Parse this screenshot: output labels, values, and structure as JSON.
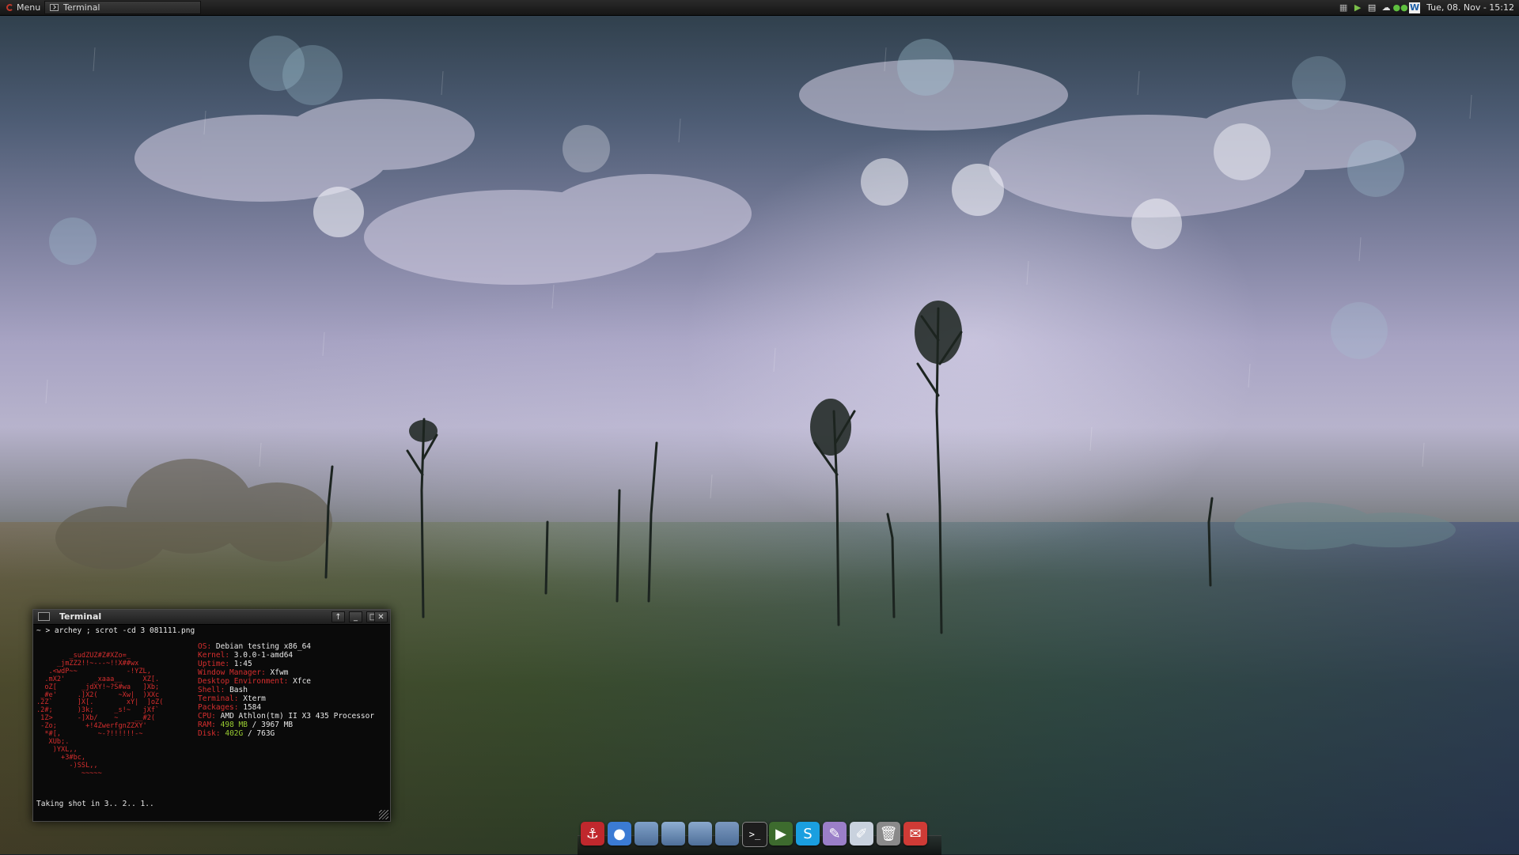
{
  "top_panel": {
    "menu_label": "Menu",
    "task_label": "Terminal",
    "clock": "Tue, 08. Nov - 15:12",
    "tray_icons": [
      "network-icon",
      "media-play-icon",
      "chat-icon",
      "cloud-icon",
      "eyes-icon",
      "writer-icon"
    ]
  },
  "terminal": {
    "title": "Terminal",
    "prompt": "~ > archey ; scrot -cd 3 081111.png",
    "ascii_logo": [
      "        _sudZUZ#Z#XZo=_",
      "     _jmZZ2!!~---~!!X##wx",
      "   .<wdP~~            -!YZL,",
      "  .mX2'       _xaaa__     XZ[.",
      "  oZ[      _jdXY!~?S#wa   ]Xb;",
      " _#e'     .]X2(     ~Xw|  )XXc",
      ".2Z`      ]X[.        xY|  ]oZ(",
      ".2#;      )3k;     _s!~   jXf`",
      " 1Z>      -]Xb/    ~    __#2(",
      " -Zo;       +!4ZwerfgnZZXY'",
      "  *#[,         ~-?!!!!!!-~",
      "   XUb;.",
      "    )YXL,,",
      "      +3#bc,",
      "        -)SSL,,",
      "           ~~~~~"
    ],
    "sysinfo": [
      {
        "key": "OS:",
        "value": "Debian testing x86_64"
      },
      {
        "key": "Kernel:",
        "value": "3.0.0-1-amd64"
      },
      {
        "key": "Uptime:",
        "value": "1:45"
      },
      {
        "key": "Window Manager:",
        "value": "Xfwm"
      },
      {
        "key": "Desktop Environment:",
        "value": "Xfce"
      },
      {
        "key": "Shell:",
        "value": "Bash"
      },
      {
        "key": "Terminal:",
        "value": "Xterm"
      },
      {
        "key": "Packages:",
        "value": "1584"
      },
      {
        "key": "CPU:",
        "value": "AMD Athlon(tm) II X3 435 Processor"
      }
    ],
    "ram": {
      "key": "RAM:",
      "used": "498 MB",
      "rest": " / 3967 MB"
    },
    "disk": {
      "key": "Disk:",
      "used": "402G",
      "rest": " / 763G"
    },
    "status_line": "Taking shot in 3.. 2.. 1..",
    "buttons": {
      "shade": "↑",
      "minimize": "_",
      "maximize": "□",
      "close": "✕"
    }
  },
  "dock": {
    "icons": [
      {
        "name": "anchor-icon",
        "glyph": "⚓",
        "color": "#c0282d"
      },
      {
        "name": "chromium-icon",
        "glyph": "●",
        "color": "#3b7bd4"
      },
      {
        "name": "folder-icon",
        "glyph": "",
        "color": "#7fa0c8"
      },
      {
        "name": "documents-folder-icon",
        "glyph": "",
        "color": "#8eaed2"
      },
      {
        "name": "downloads-folder-icon",
        "glyph": "",
        "color": "#8aa8cc"
      },
      {
        "name": "trash-folder-icon",
        "glyph": "",
        "color": "#7b98bf"
      },
      {
        "name": "terminal-icon",
        "glyph": ">_",
        "color": "#1d1d1d"
      },
      {
        "name": "media-player-icon",
        "glyph": "▶",
        "color": "#3d6b2e"
      },
      {
        "name": "skype-icon",
        "glyph": "S",
        "color": "#1a9fe0"
      },
      {
        "name": "pidgin-icon",
        "glyph": "✎",
        "color": "#9b7fc8"
      },
      {
        "name": "text-editor-icon",
        "glyph": "✐",
        "color": "#c9d2de"
      },
      {
        "name": "trash-icon",
        "glyph": "🗑",
        "color": "#8a8a8a"
      },
      {
        "name": "gmail-icon",
        "glyph": "✉",
        "color": "#cf3b36"
      }
    ]
  }
}
